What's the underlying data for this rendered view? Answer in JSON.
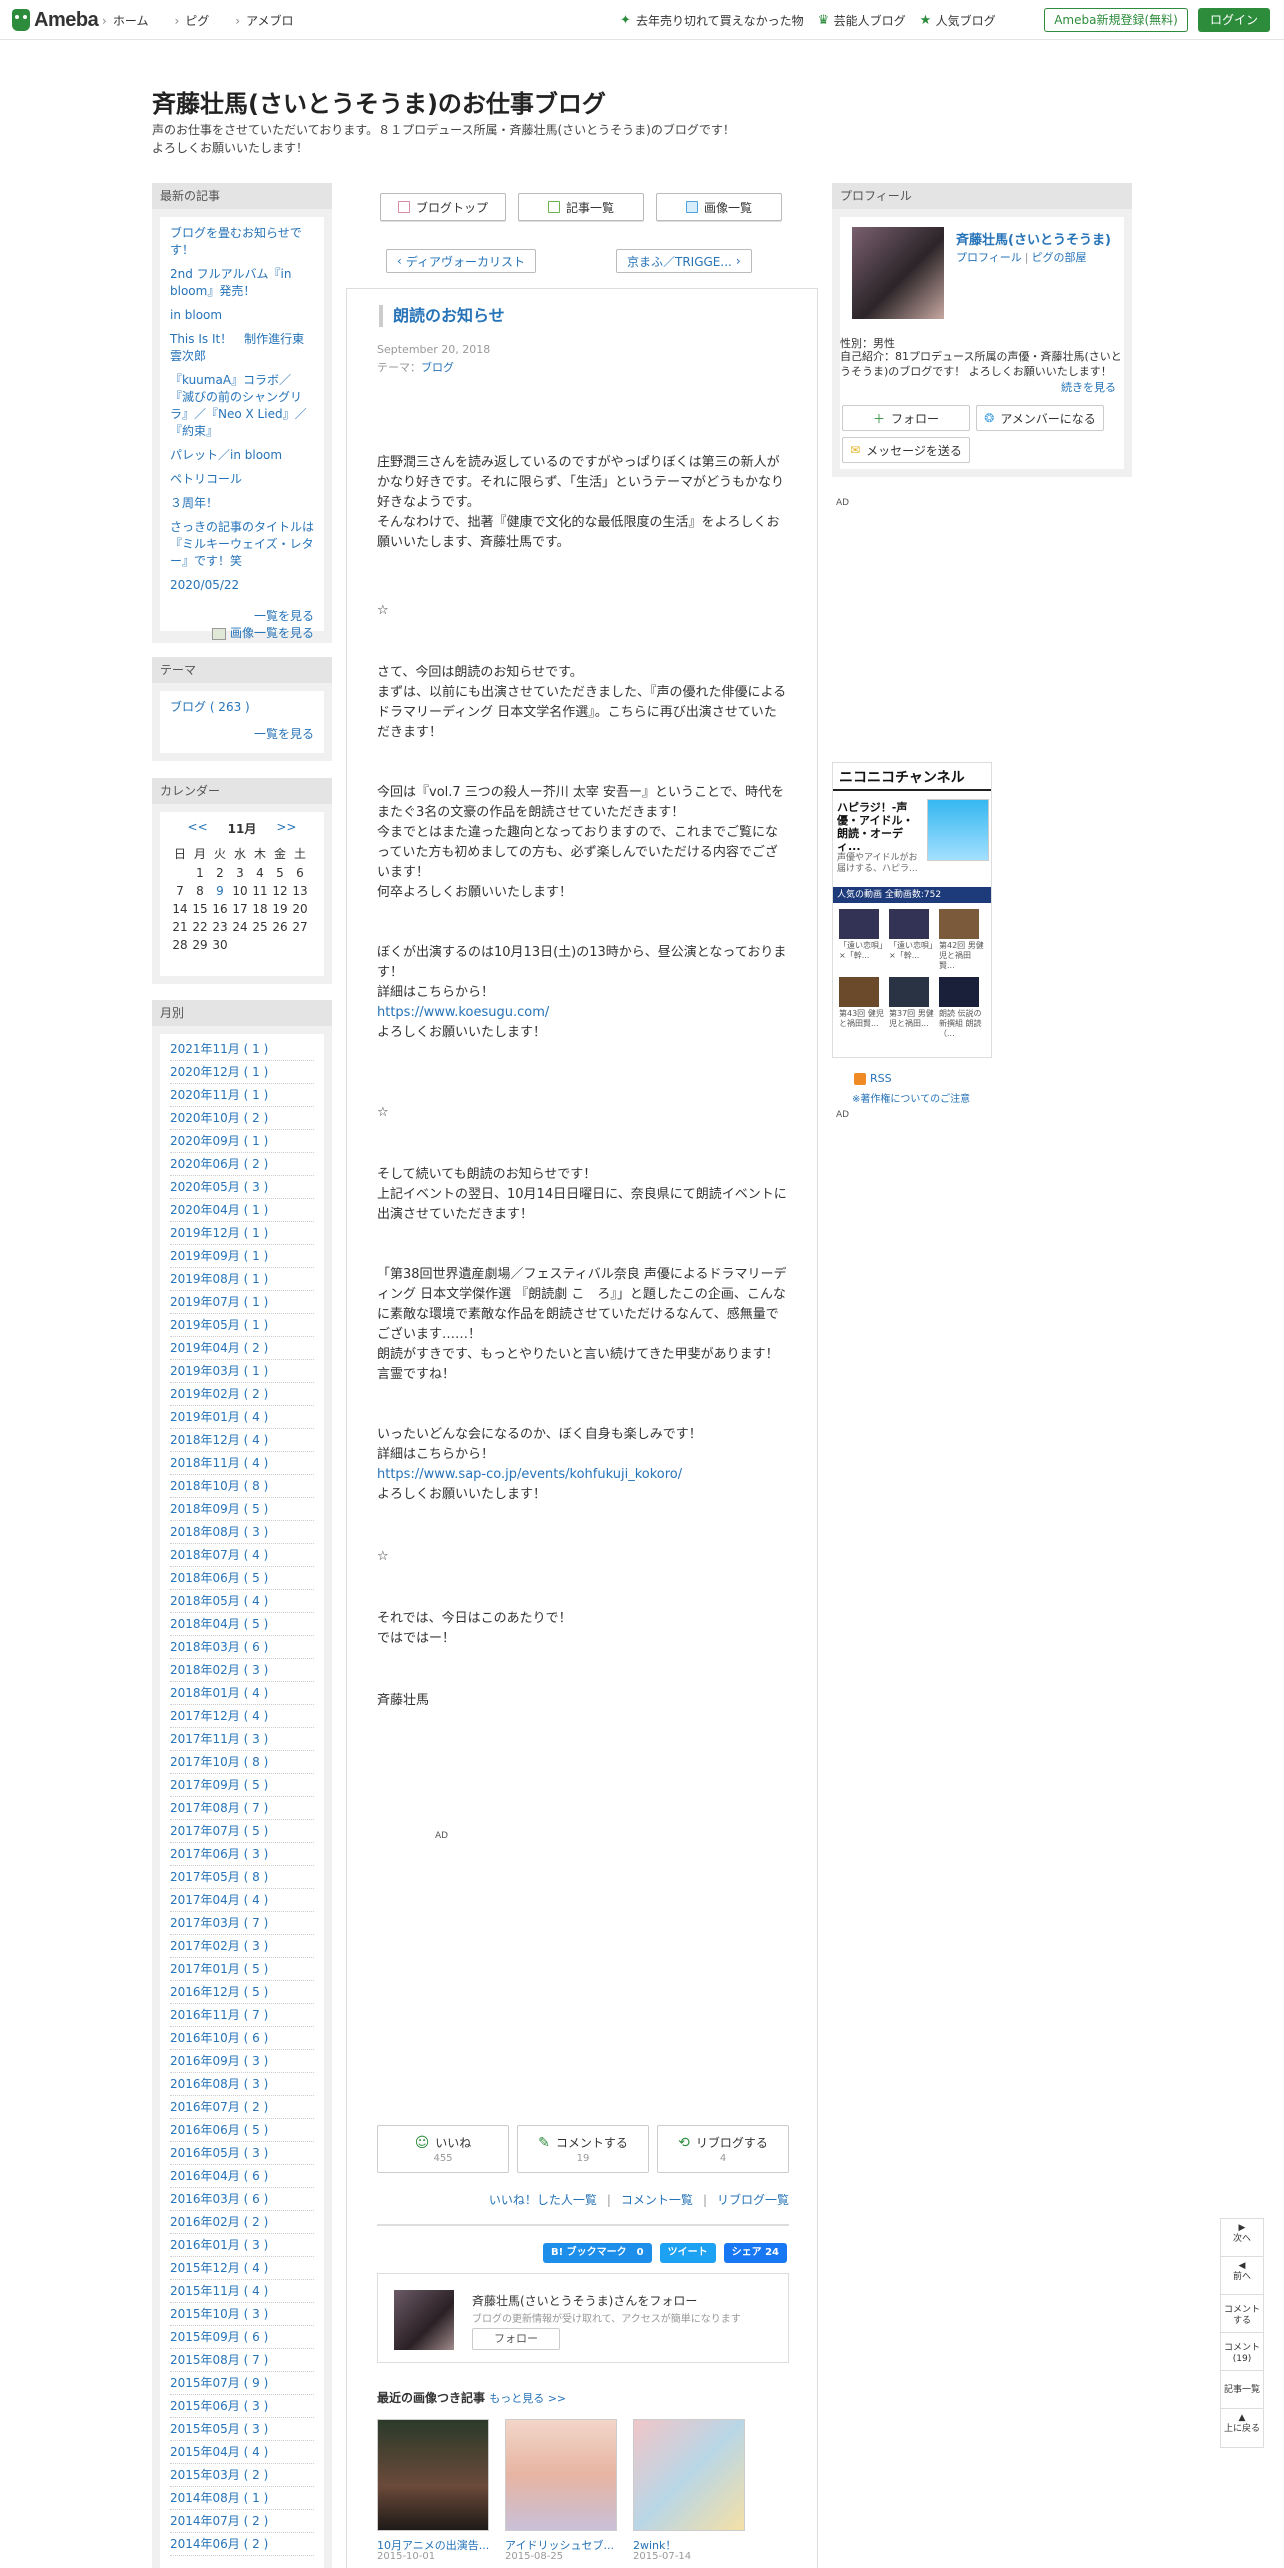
{
  "header": {
    "logo": "Ameba",
    "nav": [
      "ホーム",
      "ピグ",
      "アメブロ"
    ],
    "links": [
      "去年売り切れて買えなかった物",
      "芸能人ブログ",
      "人気ブログ"
    ],
    "register": "Ameba新規登録(無料)",
    "login": "ログイン"
  },
  "blog": {
    "title": "斉藤壮馬(さいとうそうま)のお仕事ブログ",
    "desc": "声のお仕事をさせていただいております。８１プロデュース所属・斉藤壮馬(さいとうそうま)のブログです！\nよろしくお願いいたします！"
  },
  "sidebar": {
    "recent_head": "最新の記事",
    "recent": [
      "ブログを畳むお知らせです！",
      "2nd フルアルバム『in bloom』発売！",
      "in bloom",
      "This Is It！　制作進行東雲次郎",
      "『kuumaA』コラボ／『滅びの前のシャングリラ』／『Neo X Lied』／『約束』",
      "パレット／in bloom",
      "ペトリコール",
      "３周年！",
      "さっきの記事のタイトルは『ミルキーウェイズ・レター』です！笑",
      "2020/05/22"
    ],
    "recent_more": "一覧を見る",
    "image_more": "画像一覧を見る",
    "theme_head": "テーマ",
    "theme_item": "ブログ ( 263 )",
    "theme_more": "一覧を見る",
    "calendar_head": "カレンダー",
    "cal_prev": "<<",
    "cal_month": "11月",
    "cal_next": ">>",
    "cal_days": [
      "日",
      "月",
      "火",
      "水",
      "木",
      "金",
      "土",
      "",
      "1",
      "2",
      "3",
      "4",
      "5",
      "6",
      "7",
      "8",
      "9",
      "10",
      "11",
      "12",
      "13",
      "14",
      "15",
      "16",
      "17",
      "18",
      "19",
      "20",
      "21",
      "22",
      "23",
      "24",
      "25",
      "26",
      "27",
      "28",
      "29",
      "30",
      "",
      "",
      "",
      ""
    ],
    "monthly_head": "月別",
    "months": [
      "2021年11月 ( 1 )",
      "2020年12月 ( 1 )",
      "2020年11月 ( 1 )",
      "2020年10月 ( 2 )",
      "2020年09月 ( 1 )",
      "2020年06月 ( 2 )",
      "2020年05月 ( 3 )",
      "2020年04月 ( 1 )",
      "2019年12月 ( 1 )",
      "2019年09月 ( 1 )",
      "2019年08月 ( 1 )",
      "2019年07月 ( 1 )",
      "2019年05月 ( 1 )",
      "2019年04月 ( 2 )",
      "2019年03月 ( 1 )",
      "2019年02月 ( 2 )",
      "2019年01月 ( 4 )",
      "2018年12月 ( 4 )",
      "2018年11月 ( 4 )",
      "2018年10月 ( 8 )",
      "2018年09月 ( 5 )",
      "2018年08月 ( 3 )",
      "2018年07月 ( 4 )",
      "2018年06月 ( 5 )",
      "2018年05月 ( 4 )",
      "2018年04月 ( 5 )",
      "2018年03月 ( 6 )",
      "2018年02月 ( 3 )",
      "2018年01月 ( 4 )",
      "2017年12月 ( 4 )",
      "2017年11月 ( 3 )",
      "2017年10月 ( 8 )",
      "2017年09月 ( 5 )",
      "2017年08月 ( 7 )",
      "2017年07月 ( 5 )",
      "2017年06月 ( 3 )",
      "2017年05月 ( 8 )",
      "2017年04月 ( 4 )",
      "2017年03月 ( 7 )",
      "2017年02月 ( 3 )",
      "2017年01月 ( 5 )",
      "2016年12月 ( 5 )",
      "2016年11月 ( 7 )",
      "2016年10月 ( 6 )",
      "2016年09月 ( 3 )",
      "2016年08月 ( 3 )",
      "2016年07月 ( 2 )",
      "2016年06月 ( 5 )",
      "2016年05月 ( 3 )",
      "2016年04月 ( 6 )",
      "2016年03月 ( 6 )",
      "2016年02月 ( 2 )",
      "2016年01月 ( 3 )",
      "2015年12月 ( 4 )",
      "2015年11月 ( 4 )",
      "2015年10月 ( 3 )",
      "2015年09月 ( 6 )",
      "2015年08月 ( 7 )",
      "2015年07月 ( 9 )",
      "2015年06月 ( 3 )",
      "2015年05月 ( 3 )",
      "2015年04月 ( 4 )",
      "2015年03月 ( 2 )",
      "2014年08月 ( 1 )",
      "2014年07月 ( 2 )",
      "2014年06月 ( 2 )"
    ]
  },
  "tabs": [
    "ブログトップ",
    "記事一覧",
    "画像一覧"
  ],
  "pager": {
    "prev": "ディアヴォーカリスト",
    "next": "京まふ／TRIGGE..."
  },
  "article": {
    "title": "朗読のお知らせ",
    "date": "September 20, 2018",
    "theme_label": "テーマ：",
    "theme": "ブログ",
    "paragraphs": [
      "庄野潤三さんを読み返しているのですがやっぱりぼくは第三の新人がかなり好きです。それに限らず、「生活」というテーマがどうもかなり好きなようです。\nそんなわけで、拙著『健康で文化的な最低限度の生活』をよろしくお願いいたします、斉藤壮馬です。",
      "☆",
      "さて、今回は朗読のお知らせです。\nまずは、以前にも出演させていただきました、『声の優れた俳優によるドラマリーディング 日本文学名作選』。こちらに再び出演させていただきます！",
      "今回は『vol.7 三つの殺人ー芥川 太宰 安吾ー』ということで、時代をまたぐ3名の文豪の作品を朗読させていただきます！\n今までとはまた違った趣向となっておりますので、これまでご覧になっていた方も初めましての方も、必ず楽しんでいただける内容でございます！\n何卒よろしくお願いいたします！",
      "ぼくが出演するのは10月13日(土)の13時から、昼公演となっております！\n詳細はこちらから！",
      "よろしくお願いいたします！",
      "☆",
      "そして続いても朗読のお知らせです！\n上記イベントの翌日、10月14日日曜日に、奈良県にて朗読イベントに出演させていただきます！",
      "「第38回世界遺産劇場／フェスティバル奈良 声優によるドラマリーディング 日本文学傑作選 『朗読劇 こ　ろ』」と題したこの企画、こんなに素敵な環境で素敵な作品を朗読させていただけるなんて、感無量でございます……！\n朗読がすきです、もっとやりたいと言い続けてきた甲斐があります！言霊ですね！",
      "いったいどんな会になるのか、ぼく自身も楽しみです！\n詳細はこちらから！",
      "よろしくお願いいたします！",
      "☆",
      "それでは、今日はこのあたりで！\nではではー！",
      "斉藤壮馬"
    ],
    "link1": "https://www.koesugu.com/",
    "link2": "https://www.sap-co.jp/events/kohfukuji_kokoro/",
    "ad": "AD"
  },
  "reactions": {
    "like": "いいね",
    "like_count": "455",
    "comment": "コメントする",
    "comment_count": "19",
    "reblog": "リブログする",
    "reblog_count": "4",
    "link_like": "いいね！した人一覧",
    "link_comment": "コメント一覧",
    "link_reblog": "リブログ一覧"
  },
  "share": {
    "hatena": "B! ブックマーク　0",
    "tweet": "ツイート",
    "fb": "シェア 24"
  },
  "follow": {
    "name": "斉藤壮馬(さいとうそうま)さんをフォロー",
    "sub": "ブログの更新情報が受け取れて、アクセスが簡単になります",
    "btn": "フォロー"
  },
  "recent_images": {
    "title": "最近の画像つき記事",
    "more": "もっと見る >>",
    "items": [
      {
        "title": "10月アニメの出演告...",
        "date": "2015-10-01"
      },
      {
        "title": "アイドリッシュセブ...",
        "date": "2015-08-25"
      },
      {
        "title": "2wink！",
        "date": "2015-07-14"
      }
    ]
  },
  "profile": {
    "head": "プロフィール",
    "name": "斉藤壮馬(さいとうそうま)",
    "link1": "プロフィール",
    "link2": "ピグの部屋",
    "gender": "性別：男性",
    "intro": "自己紹介：81プロデュース所属の声優・斉藤壮馬(さいとうそうま)のブログです！ よろしくお願いいたします！",
    "more": "続きを見る",
    "follow": "フォロー",
    "member": "アメンバーになる",
    "message": "メッセージを送る"
  },
  "right_ad": "AD",
  "nico": {
    "logo": "ニコニコチャンネル",
    "title": "ハピラジ！-声優・アイドル・朗読・オーディ...",
    "sub": "声優やアイドルがお届けする、ハピラ...",
    "bar": "人気の動画 全動画数:752",
    "videos": [
      "「遠い恋唄」×「幹...",
      "「遠い恋唄」×「幹...",
      "第42回 男健児と禍田賢...",
      "第43回 健児と禍田賢...",
      "第37回 男健児と禍田...",
      "朗読 伝説の新撰組 朗読（..."
    ]
  },
  "rss": {
    "label": "RSS",
    "note": "※著作権についてのご注意"
  },
  "right_ad2": "AD",
  "floatnav": [
    "次へ",
    "前へ",
    "コメントする",
    "コメント(19)",
    "記事一覧",
    "上に戻る"
  ]
}
